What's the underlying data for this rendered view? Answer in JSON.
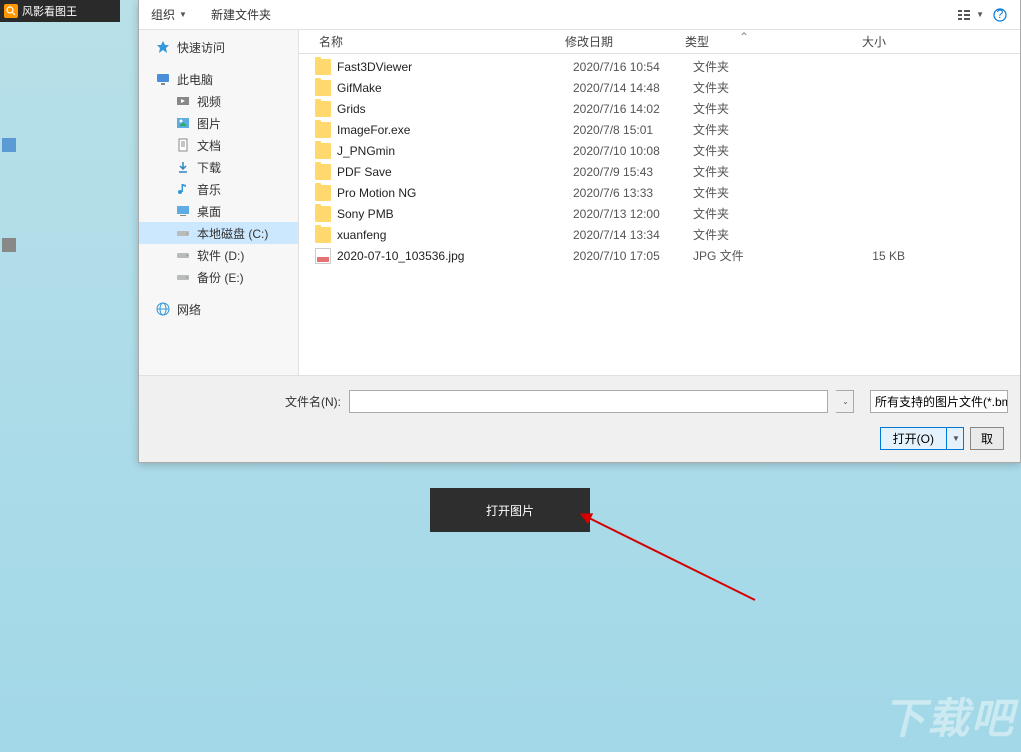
{
  "app": {
    "title": "风影看图王"
  },
  "toolbar": {
    "organize": "组织",
    "new_folder": "新建文件夹"
  },
  "sidebar": {
    "quick_access": "快速访问",
    "this_pc": "此电脑",
    "videos": "视频",
    "pictures": "图片",
    "documents": "文档",
    "downloads": "下载",
    "music": "音乐",
    "desktop": "桌面",
    "local_disk_c": "本地磁盘 (C:)",
    "software_d": "软件 (D:)",
    "backup_e": "备份 (E:)",
    "network": "网络"
  },
  "headers": {
    "name": "名称",
    "date": "修改日期",
    "type": "类型",
    "size": "大小"
  },
  "files": [
    {
      "name": "Fast3DViewer",
      "date": "2020/7/16 10:54",
      "type": "文件夹",
      "size": "",
      "kind": "folder"
    },
    {
      "name": "GifMake",
      "date": "2020/7/14 14:48",
      "type": "文件夹",
      "size": "",
      "kind": "folder"
    },
    {
      "name": "Grids",
      "date": "2020/7/16 14:02",
      "type": "文件夹",
      "size": "",
      "kind": "folder"
    },
    {
      "name": "ImageFor.exe",
      "date": "2020/7/8 15:01",
      "type": "文件夹",
      "size": "",
      "kind": "folder"
    },
    {
      "name": "J_PNGmin",
      "date": "2020/7/10 10:08",
      "type": "文件夹",
      "size": "",
      "kind": "folder"
    },
    {
      "name": "PDF Save",
      "date": "2020/7/9 15:43",
      "type": "文件夹",
      "size": "",
      "kind": "folder"
    },
    {
      "name": "Pro Motion NG",
      "date": "2020/7/6 13:33",
      "type": "文件夹",
      "size": "",
      "kind": "folder"
    },
    {
      "name": "Sony PMB",
      "date": "2020/7/13 12:00",
      "type": "文件夹",
      "size": "",
      "kind": "folder"
    },
    {
      "name": "xuanfeng",
      "date": "2020/7/14 13:34",
      "type": "文件夹",
      "size": "",
      "kind": "folder"
    },
    {
      "name": "2020-07-10_103536.jpg",
      "date": "2020/7/10 17:05",
      "type": "JPG 文件",
      "size": "15 KB",
      "kind": "jpg"
    }
  ],
  "bottom": {
    "filename_label": "文件名(N):",
    "filetype_label": "所有支持的图片文件(*.bmp",
    "open": "打开(O)",
    "cancel": "取"
  },
  "center_button": "打开图片",
  "watermark": "下载吧"
}
